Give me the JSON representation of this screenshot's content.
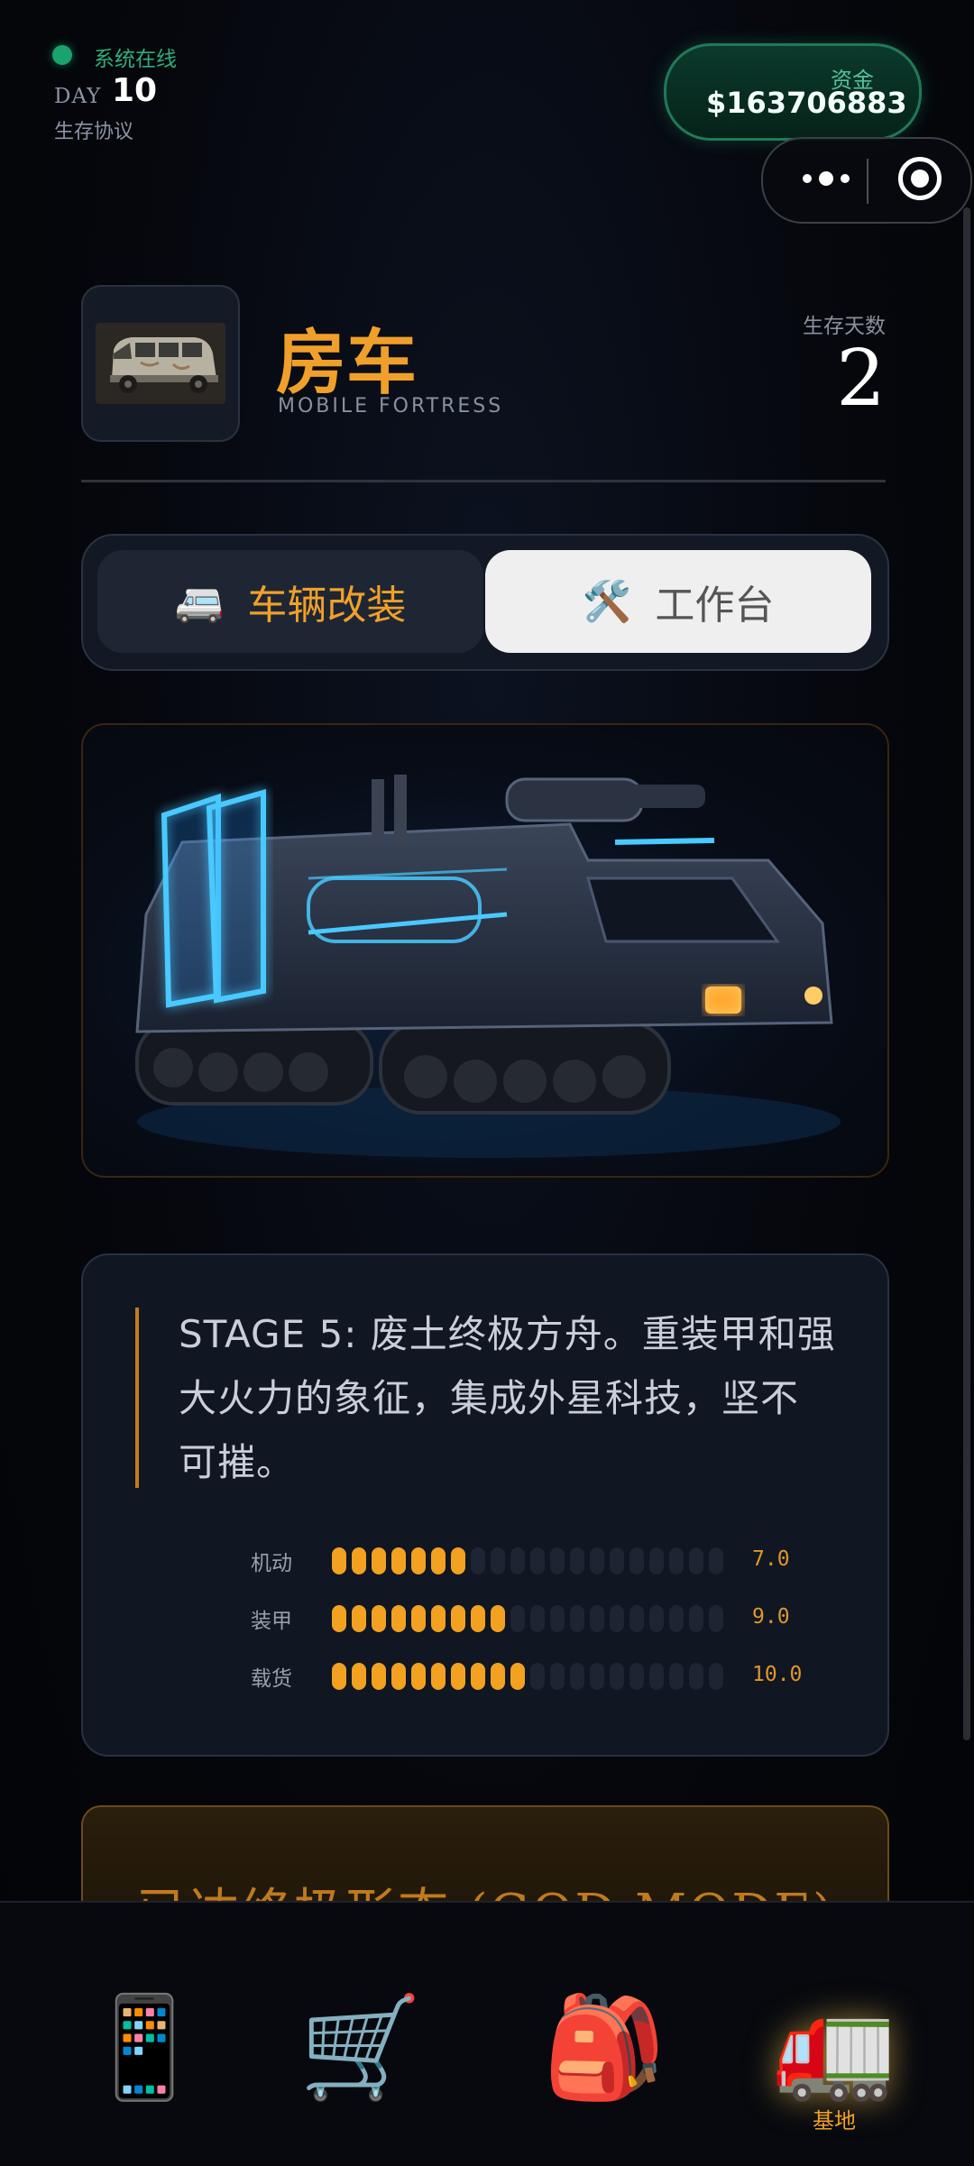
{
  "status": {
    "online_text": "系统在线",
    "day_prefix": "DAY",
    "day_value": "10",
    "protocol": "生存协议"
  },
  "funds": {
    "label": "资金",
    "value": "$163706883"
  },
  "header": {
    "title": "房车",
    "subtitle": "MOBILE FORTRESS",
    "survival_label": "生存天数",
    "survival_days": "2"
  },
  "tabs": [
    {
      "icon": "🚐",
      "label": "车辆改装",
      "active": true
    },
    {
      "icon": "🛠️",
      "label": "工作台",
      "active": false
    }
  ],
  "description": "STAGE 5: 废土终极方舟。重装甲和强大火力的象征，集成外星科技，坚不可摧。",
  "stats": [
    {
      "label": "机动",
      "value": "7.0",
      "level": 7
    },
    {
      "label": "装甲",
      "value": "9.0",
      "level": 9
    },
    {
      "label": "载货",
      "value": "10.0",
      "level": 10
    }
  ],
  "stat_max": 20,
  "banner": "已达终极形态 (GOD MODE)",
  "nav": [
    {
      "icon": "📱",
      "label": ""
    },
    {
      "icon": "🛒",
      "label": ""
    },
    {
      "icon": "🎒",
      "label": ""
    },
    {
      "icon": "🚛",
      "label": "基地"
    }
  ],
  "colors": {
    "accent": "#f0a02a",
    "online": "#1aa36c",
    "funds_border": "#1f7a57"
  }
}
